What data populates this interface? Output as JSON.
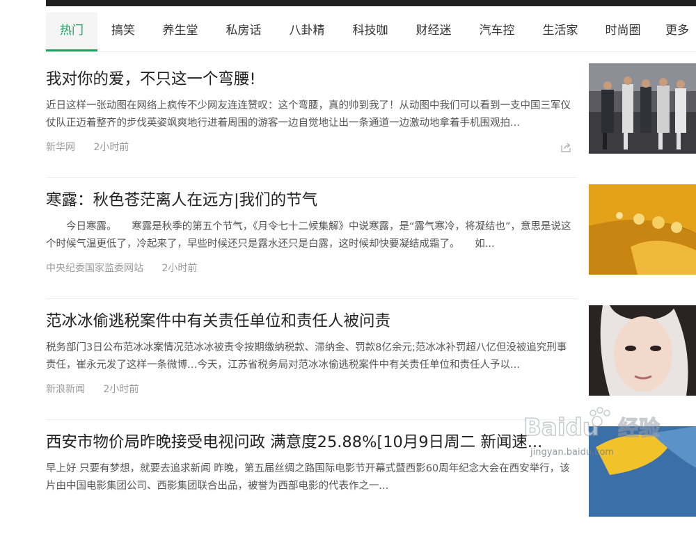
{
  "tabs": [
    "热门",
    "搞笑",
    "养生堂",
    "私房话",
    "八卦精",
    "科技咖",
    "财经迷",
    "汽车控",
    "生活家",
    "时尚圈",
    "更多"
  ],
  "active_tab": 0,
  "articles": [
    {
      "title": "我对你的爱，不只这一个弯腰!",
      "summary": "近日这样一张动图在网络上疯传不少网友连连赞叹：这个弯腰，真的帅到我了！从动图中我们可以看到一支中国三军仪仗队正迈着整齐的步伐英姿飒爽地行进着周围的游客一边自觉地让出一条通道一边激动地拿着手机围观拍...",
      "source": "新华网",
      "time": "2小时前",
      "thumb": "honor-guard-photo"
    },
    {
      "title": "寒露：秋色苍茫离人在远方|我们的节气",
      "summary": "　　今日寒露。　　寒露是秋季的第五个节气，《月令七十二候集解》中说寒露，是“露气寒冷，将凝结也”，意思是说这个时候气温更低了，冷起来了，早些时候还只是露水还只是白露，这时候却快要凝结成霜了。　　如...",
      "source": "中央纪委国家监委网站",
      "time": "2小时前",
      "thumb": "dew-on-leaf-photo"
    },
    {
      "title": "范冰冰偷逃税案件中有关责任单位和责任人被问责",
      "summary": "税务部门3日公布范冰冰案情况范冰冰被责令按期缴纳税款、滞纳金、罚款8亿余元;范冰冰补罚超八亿但没被追究刑事责任，崔永元发了这样一条微博…今天，江苏省税务局对范冰冰偷逃税案件中有关责任单位和责任人予以...",
      "source": "新浪新闻",
      "time": "2小时前",
      "thumb": "portrait-photo"
    },
    {
      "title": "西安市物价局昨晚接受电视问政 满意度25.88%[10月9日周二 新闻速...",
      "summary": "早上好 只要有梦想，就要去追求新闻 昨晚，第五届丝绸之路国际电影节开幕式暨西影60周年纪念大会在西安举行，该片由中国电影集团公司、西影集团联合出品，被誉为西部电影的代表作之一...",
      "source": "",
      "time": "",
      "thumb": "yellow-leaf-photo"
    }
  ],
  "watermark": {
    "brand": "Baidu",
    "cn": "经验",
    "url": "jingyan.baidu.com"
  },
  "colors": {
    "accent": "#1aa260",
    "text": "#222222",
    "muted": "#9a9a9a"
  }
}
